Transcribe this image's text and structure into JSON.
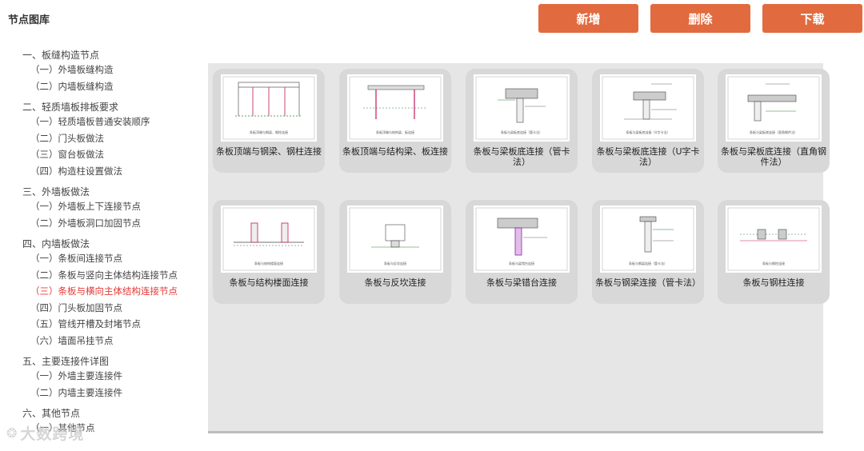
{
  "header": {
    "title": "节点图库",
    "buttons": {
      "add": "新增",
      "delete": "删除",
      "download": "下载"
    }
  },
  "tree": [
    {
      "title": "一、板缝构造节点",
      "items": [
        "（一）外墙板缝构造",
        "（二）内墙板缝构造"
      ]
    },
    {
      "title": "二、轻质墙板排板要求",
      "items": [
        "（一）轻质墙板普通安装顺序",
        "（二）门头板做法",
        "（三）窗台板做法",
        "（四）构造柱设置做法"
      ]
    },
    {
      "title": "三、外墙板做法",
      "items": [
        "（一）外墙板上下连接节点",
        "（二）外墙板洞口加固节点"
      ]
    },
    {
      "title": "四、内墙板做法",
      "items": [
        "（一）条板间连接节点",
        "（二）条板与竖向主体结构连接节点",
        "（三）条板与横向主体结构连接节点",
        "（四）门头板加固节点",
        "（五）管线开槽及封堵节点",
        "（六）墙面吊挂节点"
      ],
      "active_index": 2
    },
    {
      "title": "五、主要连接件详图",
      "items": [
        "（一）外墙主要连接件",
        "（二）内墙主要连接件"
      ]
    },
    {
      "title": "六、其他节点",
      "items": [
        "（一）其他节点"
      ]
    }
  ],
  "cards": [
    {
      "label": "条板顶端与钢梁、钢柱连接",
      "caption": "条板顶端与钢梁、钢柱连接"
    },
    {
      "label": "条板顶端与结构梁、板连接",
      "caption": "条板顶端与结构梁、板连接"
    },
    {
      "label": "条板与梁板底连接（管卡法）",
      "caption": "条板与梁板底连接（管卡法）"
    },
    {
      "label": "条板与梁板底连接（U字卡法）",
      "caption": "条板与梁板底连接（U字卡法）"
    },
    {
      "label": "条板与梁板底连接（直角钢件法）",
      "caption": "条板与梁板底连接（直角钢件法）"
    },
    {
      "label": "条板与结构楼面连接",
      "caption": "条板与结构楼面连接"
    },
    {
      "label": "条板与反坎连接",
      "caption": "条板与反坎连接"
    },
    {
      "label": "条板与梁错台连接",
      "caption": "条板与梁错台连接"
    },
    {
      "label": "条板与钢梁连接（管卡法）",
      "caption": "条板与钢梁连接（管卡法）"
    },
    {
      "label": "条板与钢柱连接",
      "caption": "条板与钢柱连接"
    }
  ],
  "watermark": "大数跨境",
  "colors": {
    "accent": "#e26a3f",
    "active": "#e53935",
    "gallery_bg": "#e6e6e6",
    "card_bg": "#d8d8d8"
  }
}
